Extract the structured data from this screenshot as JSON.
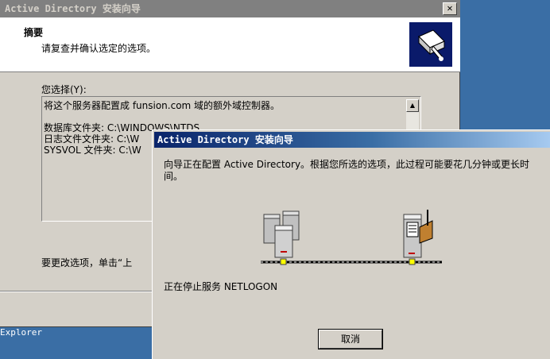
{
  "back_window": {
    "title": "Active Directory 安装向导",
    "close_glyph": "✕",
    "header_title": "摘要",
    "header_subtitle": "请复查并确认选定的选项。",
    "selection_label": "您选择(Y):",
    "summary_lines": [
      "将这个服务器配置成 funsion.com 域的额外域控制器。",
      "数据库文件夹: C:\\WINDOWS\\NTDS",
      "日志文件文件夹: C:\\W",
      "SYSVOL 文件夹: C:\\W"
    ],
    "change_text": "要更改选项，单击“上"
  },
  "taskbar": {
    "text": "Explorer"
  },
  "front_dialog": {
    "title": "Active Directory 安装向导",
    "message": "向导正在配置 Active Directory。根据您所选的选项，此过程可能要花几分钟或更长时间。",
    "status": "正在停止服务 NETLOGON",
    "cancel_label": "取消"
  },
  "colors": {
    "desktop": "#3a6ea5",
    "title_active_start": "#0a246a",
    "title_inactive": "#808080",
    "face": "#d4d0c8"
  },
  "icons": [
    "close-icon",
    "wizard-logo-icon",
    "server-cluster-icon",
    "server-document-icon",
    "scroll-up-icon",
    "scroll-down-icon"
  ]
}
